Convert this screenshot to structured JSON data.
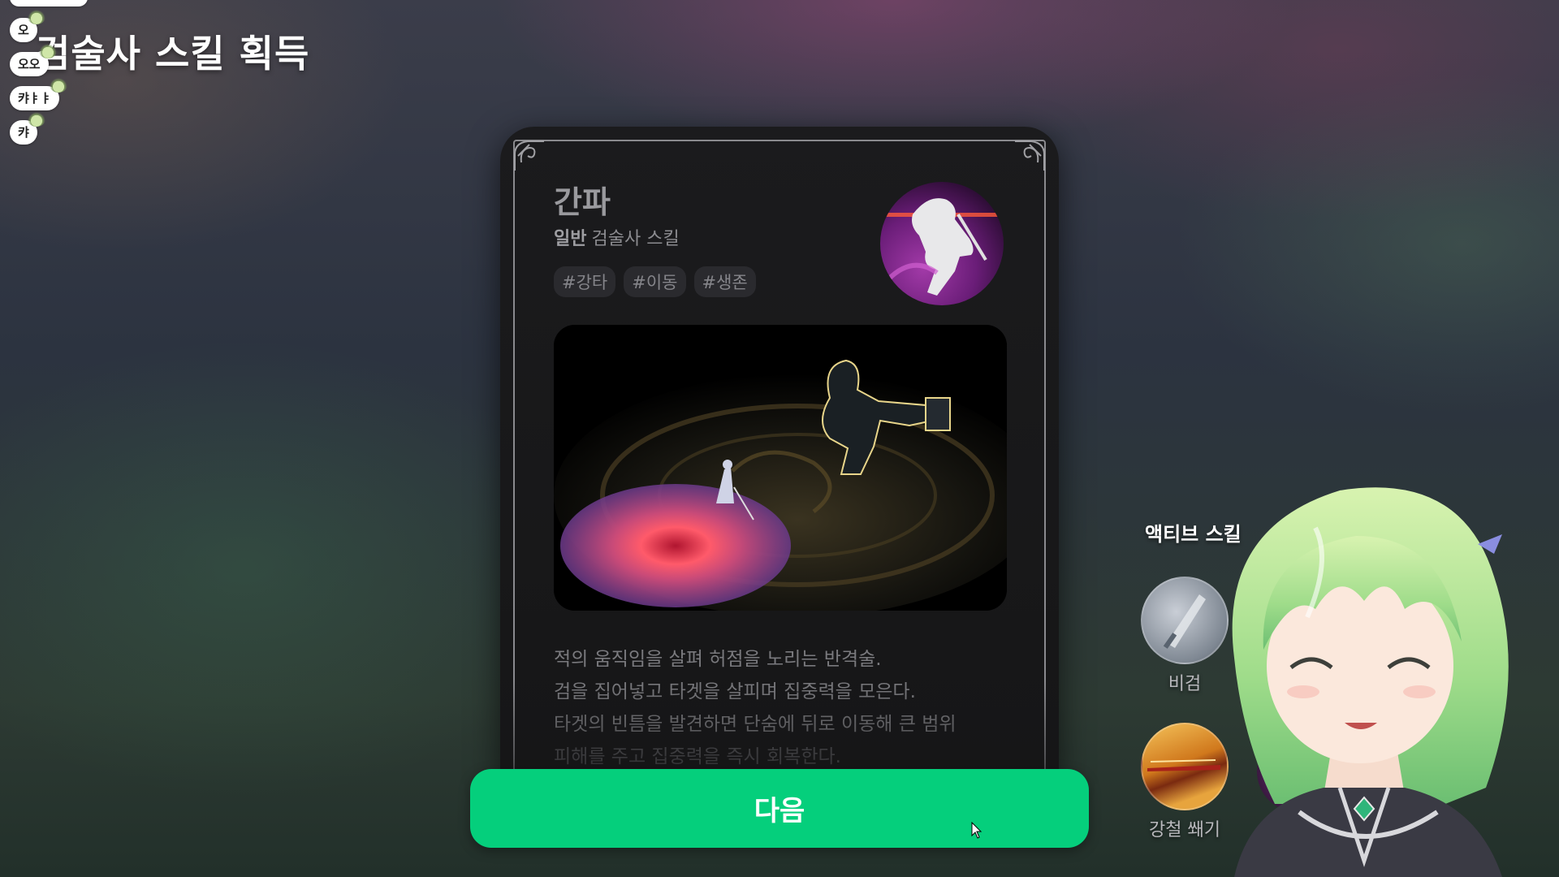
{
  "page_title": "검술사 스킬 획득",
  "chat": [
    {
      "text": "오"
    },
    {
      "text": "오오"
    },
    {
      "text": "캬ㅑㅑ"
    },
    {
      "text": "캬"
    }
  ],
  "card": {
    "skill_name": "간파",
    "rarity": "일반",
    "skill_class": "검술사 스킬",
    "tags": [
      "#강타",
      "#이동",
      "#생존"
    ],
    "description": [
      "적의 움직임을 살펴 허점을 노리는 반격술.",
      "검을 집어넣고 타겟을 살피며 집중력을 모은다.",
      "타겟의 빈틈을 발견하면 단숨에 뒤로 이동해 큰 범위",
      "피해를 주고 집중력을 즉시 회복한다."
    ]
  },
  "next_button": {
    "label": "다음"
  },
  "active_skills": {
    "title": "액티브 스킬",
    "items": [
      {
        "label": "비검",
        "icon": "sword-icon"
      },
      {
        "label": "강철 쐐기",
        "icon": "steel-wedge-icon"
      }
    ]
  },
  "colors": {
    "accent": "#05cf7c",
    "card_bg": "#1b1b1d",
    "tag_bg": "#2a2a2e",
    "skill_icon_purple": "#a23aa8"
  }
}
